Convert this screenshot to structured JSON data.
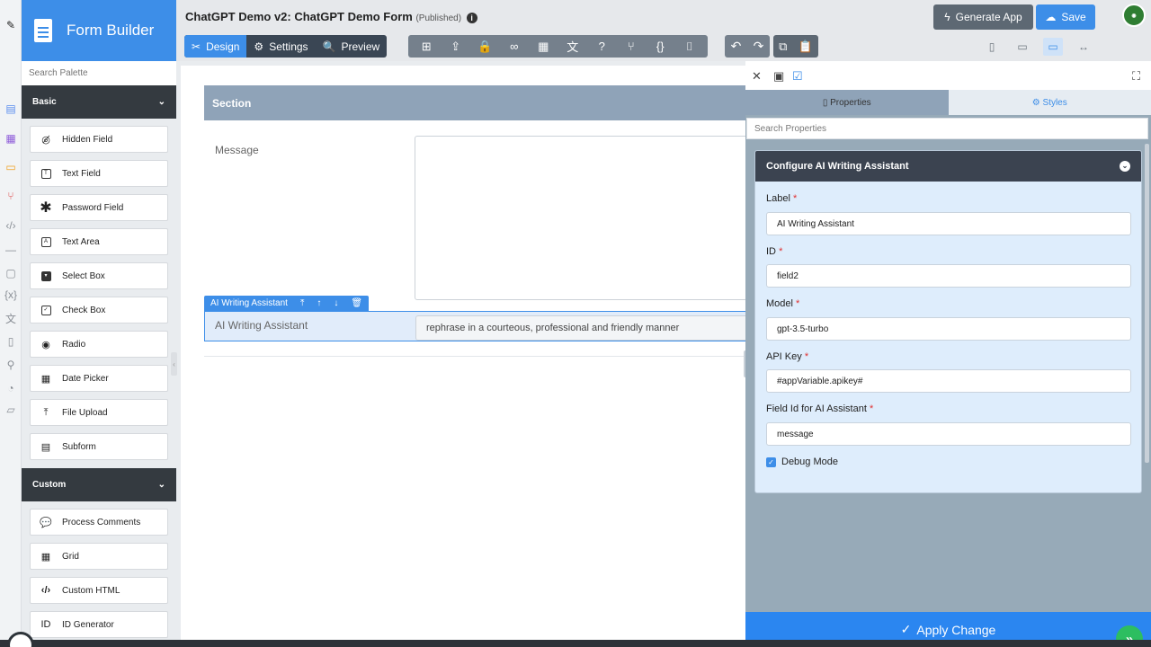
{
  "app": {
    "title": "Form Builder"
  },
  "rail_icons": [
    "form-icon",
    "grid-icon",
    "monitor-icon",
    "flow-icon",
    "code-icon",
    "note-icon",
    "variable-icon",
    "translate-icon",
    "doc-icon",
    "plugin-icon",
    "gauge-icon",
    "report-icon"
  ],
  "palette": {
    "search_placeholder": "Search Palette",
    "basic": {
      "label": "Basic",
      "items": [
        {
          "label": "Hidden Field",
          "icon": "eye-slash-icon"
        },
        {
          "label": "Text Field",
          "icon": "text-field-icon"
        },
        {
          "label": "Password Field",
          "icon": "asterisk-icon"
        },
        {
          "label": "Text Area",
          "icon": "text-area-icon"
        },
        {
          "label": "Select Box",
          "icon": "select-box-icon"
        },
        {
          "label": "Check Box",
          "icon": "checkbox-icon"
        },
        {
          "label": "Radio",
          "icon": "radio-icon"
        },
        {
          "label": "Date Picker",
          "icon": "calendar-icon"
        },
        {
          "label": "File Upload",
          "icon": "upload-icon"
        },
        {
          "label": "Subform",
          "icon": "subform-icon"
        }
      ]
    },
    "custom": {
      "label": "Custom",
      "items": [
        {
          "label": "Process Comments",
          "icon": "comments-icon"
        },
        {
          "label": "Grid",
          "icon": "grid-icon"
        },
        {
          "label": "Custom HTML",
          "icon": "code-icon"
        },
        {
          "label": "ID Generator",
          "icon": "id-icon"
        }
      ]
    }
  },
  "header": {
    "form_title": "ChatGPT Demo v2: ChatGPT Demo Form",
    "status": "(Published)",
    "modes": {
      "design": "Design",
      "settings": "Settings",
      "preview": "Preview"
    },
    "generate_app": "Generate App",
    "save": "Save"
  },
  "canvas": {
    "section_title": "Section",
    "message_label": "Message",
    "ai_strip_label": "AI Writing Assistant",
    "ai_field_label": "AI Writing Assistant",
    "ai_field_value": "rephrase in a courteous, professional and friendly manner"
  },
  "properties": {
    "tabs": {
      "properties": "Properties",
      "styles": "Styles"
    },
    "search_placeholder": "Search Properties",
    "card_title": "Configure AI Writing Assistant",
    "fields": {
      "label": {
        "label": "Label",
        "value": "AI Writing Assistant"
      },
      "id": {
        "label": "ID",
        "value": "field2"
      },
      "model": {
        "label": "Model",
        "value": "gpt-3.5-turbo"
      },
      "api_key": {
        "label": "API Key",
        "value": "#appVariable.apikey#"
      },
      "field_id": {
        "label": "Field Id for AI Assistant",
        "value": "message"
      }
    },
    "debug_label": "Debug Mode",
    "debug_checked": true,
    "apply_label": "Apply Change"
  },
  "colors": {
    "accent": "#3d8ee8",
    "dark": "#343a40",
    "success": "#2dbe60"
  }
}
